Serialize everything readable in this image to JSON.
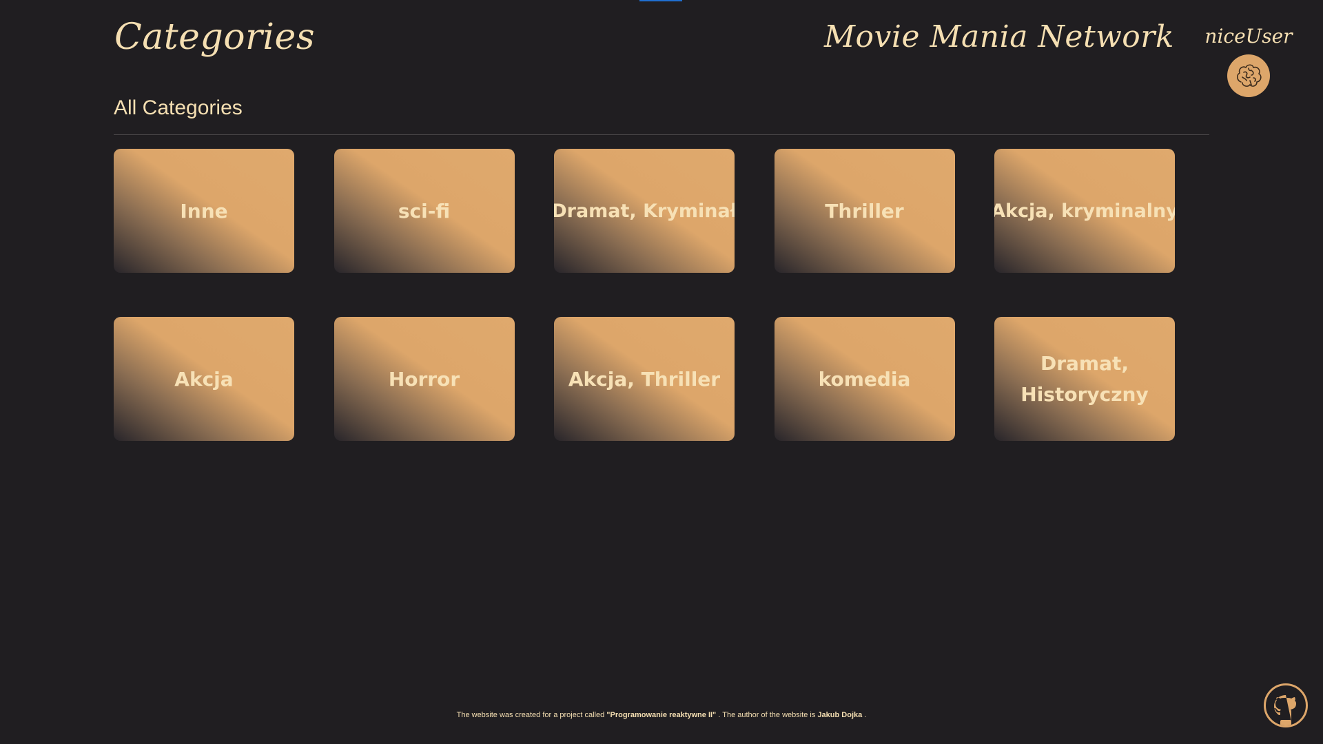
{
  "header": {
    "page_title": "Categories",
    "brand": "Movie Mania Network",
    "username": "niceUser"
  },
  "section": {
    "title": "All Categories"
  },
  "categories": [
    {
      "label": "Inne"
    },
    {
      "label": "sci-fi"
    },
    {
      "label": "Dramat, Kryminał"
    },
    {
      "label": "Thriller"
    },
    {
      "label": "Akcja, kryminalny"
    },
    {
      "label": "Akcja"
    },
    {
      "label": "Horror"
    },
    {
      "label": "Akcja, Thriller"
    },
    {
      "label": "komedia"
    },
    {
      "label": "Dramat, Historyczny"
    }
  ],
  "footer": {
    "prefix": "The website was created for a project called ",
    "project": "\"Programowanie reaktywne II\"",
    "middle": " . The author of the website is ",
    "author": "Jakub Dojka",
    "suffix": " ."
  },
  "icons": {
    "avatar": "brain-icon",
    "github": "github-icon"
  },
  "colors": {
    "background": "#201e21",
    "accent": "#dda66a",
    "text": "#f5dfb2"
  }
}
